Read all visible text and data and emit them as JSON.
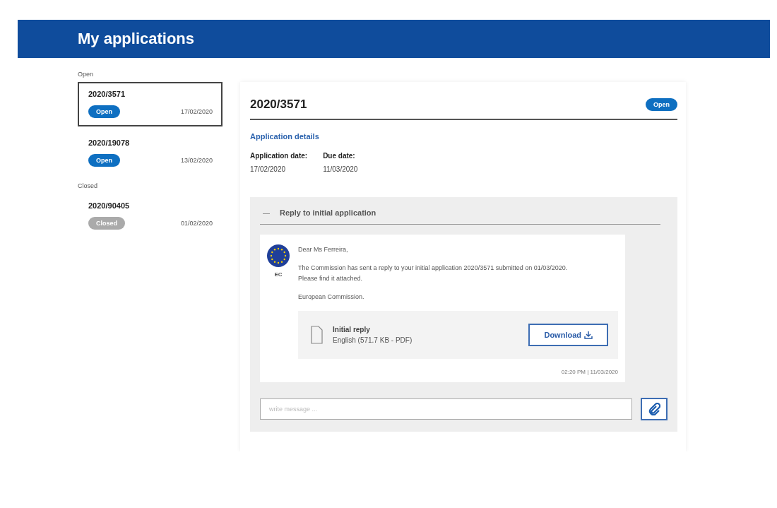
{
  "header": {
    "title": "My applications"
  },
  "sidebar": {
    "groups": [
      {
        "label": "Open",
        "items": [
          {
            "number": "2020/3571",
            "status": {
              "label": "Open",
              "kind": "open"
            },
            "date": "17/02/2020",
            "selected": true
          },
          {
            "number": "2020/19078",
            "status": {
              "label": "Open",
              "kind": "open"
            },
            "date": "13/02/2020",
            "selected": false
          }
        ]
      },
      {
        "label": "Closed",
        "items": [
          {
            "number": "2020/90405",
            "status": {
              "label": "Closed",
              "kind": "closed"
            },
            "date": "01/02/2020",
            "selected": false
          }
        ]
      }
    ]
  },
  "detail": {
    "number": "2020/3571",
    "status": {
      "label": "Open",
      "kind": "open"
    },
    "section_title": "Application details",
    "fields": [
      {
        "label": "Application date:",
        "value": "17/02/2020"
      },
      {
        "label": "Due date:",
        "value": "11/03/2020"
      }
    ],
    "thread": {
      "title": "Reply to initial application",
      "expanded": true,
      "toggle": "—",
      "message": {
        "sender": "EC",
        "paragraphs": [
          "Dear Ms Ferreira,",
          "The Commission has sent a reply to your initial application 2020/3571 submitted on 01/03/2020.\nPlease find it attached.",
          "European Commission."
        ],
        "attachment": {
          "title": "Initial reply",
          "meta": "English (571.7 KB - PDF)",
          "button": "Download"
        },
        "timestamp": "02:20 PM | 11/03/2020"
      },
      "composer": {
        "placeholder": "write message ..."
      }
    }
  }
}
